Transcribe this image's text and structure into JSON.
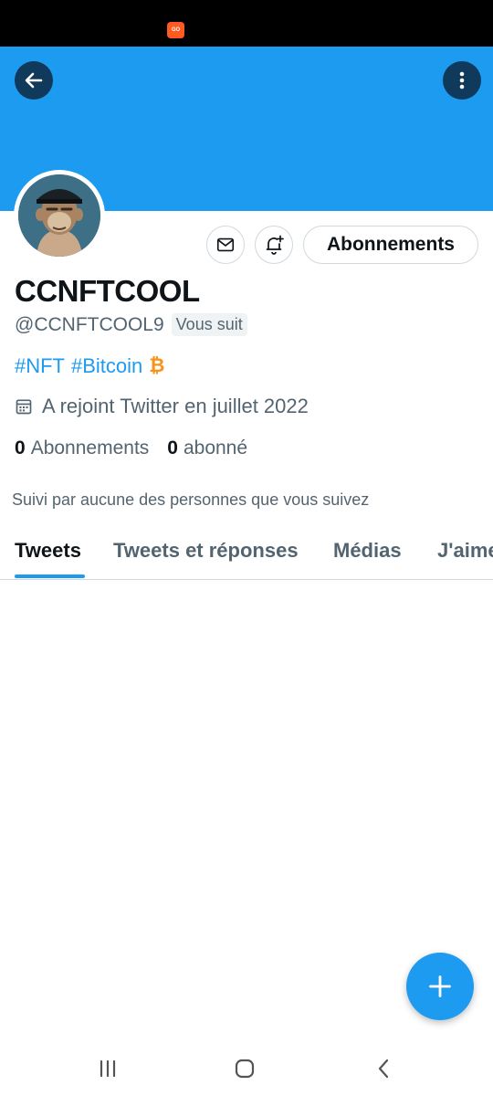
{
  "status_bar": {
    "app_badge": "GO"
  },
  "header": {
    "back_icon": "arrow-left-icon",
    "more_icon": "more-vertical-icon",
    "banner_color": "#1d9bf0"
  },
  "profile": {
    "display_name": "CCNFTCOOL",
    "handle": "@CCNFTCOOL9",
    "follows_you": "Vous suit",
    "bio_tags": [
      "#NFT",
      "#Bitcoin"
    ],
    "bio_emoji": "₿",
    "joined": "A rejoint Twitter en juillet 2022",
    "following_count": "0",
    "following_label": "Abonnements",
    "followers_count": "0",
    "followers_label": "abonné",
    "followed_by": "Suivi par aucune des personnes que vous suivez"
  },
  "actions": {
    "message_icon": "mail-icon",
    "notify_icon": "bell-plus-icon",
    "follow_label": "Abonnements"
  },
  "tabs": [
    {
      "label": "Tweets",
      "active": true
    },
    {
      "label": "Tweets et réponses",
      "active": false
    },
    {
      "label": "Médias",
      "active": false
    },
    {
      "label": "J'aime",
      "active": false
    }
  ],
  "fab": {
    "icon": "plus-icon"
  },
  "nav": {
    "recents_icon": "recents-icon",
    "home_icon": "home-icon",
    "back_icon": "back-chevron-icon"
  },
  "colors": {
    "accent": "#1d9bf0",
    "bitcoin": "#f7931a",
    "muted": "#536471"
  }
}
